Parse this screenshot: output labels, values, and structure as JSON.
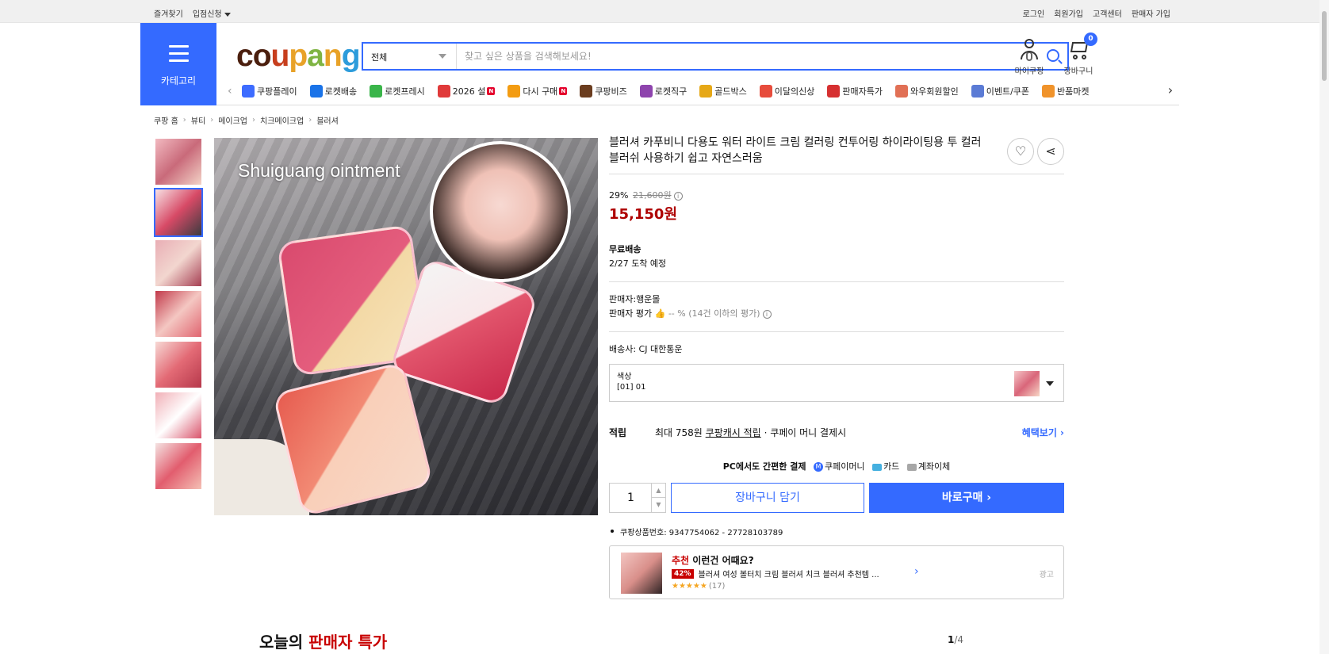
{
  "topbar": {
    "left": [
      "즐겨찾기",
      "입점신청"
    ],
    "right": [
      "로그인",
      "회원가입",
      "고객센터",
      "판매자 가입"
    ]
  },
  "header": {
    "category_label": "카테고리",
    "logo": "coupang",
    "logo_colors": [
      "#4b1f0e",
      "#c73e1d",
      "#e8a228",
      "#7fb443",
      "#2d9cdb"
    ],
    "search_category": "전체",
    "search_placeholder": "찾고 싶은 상품을 검색해보세요!",
    "mycoupang": "마이쿠팡",
    "cart": "장바구니",
    "cart_count": "0"
  },
  "nav": [
    {
      "label": "쿠팡플레이",
      "icon": "play-icon",
      "color": "#3d6cff",
      "badge": ""
    },
    {
      "label": "로켓배송",
      "icon": "rocket-icon",
      "color": "#1a73e8",
      "badge": ""
    },
    {
      "label": "로켓프레시",
      "icon": "rocket-fresh-icon",
      "color": "#3ab54a",
      "badge": ""
    },
    {
      "label": "2026 설",
      "icon": "gift-icon",
      "color": "#e03a3a",
      "badge": "N"
    },
    {
      "label": "다시 구매",
      "icon": "house-icon",
      "color": "#f39c12",
      "badge": "N"
    },
    {
      "label": "쿠팡비즈",
      "icon": "biz-icon",
      "color": "#6b3d1f",
      "badge": ""
    },
    {
      "label": "로켓직구",
      "icon": "rocket-global-icon",
      "color": "#8e44ad",
      "badge": ""
    },
    {
      "label": "골드박스",
      "icon": "goldbox-icon",
      "color": "#e6a817",
      "badge": ""
    },
    {
      "label": "이달의신상",
      "icon": "new-icon",
      "color": "#e74c3c",
      "badge": ""
    },
    {
      "label": "판매자특가",
      "icon": "percent-icon",
      "color": "#d63031",
      "badge": ""
    },
    {
      "label": "와우회원할인",
      "icon": "wow-icon",
      "color": "#e17055",
      "badge": ""
    },
    {
      "label": "이벤트/쿠폰",
      "icon": "coupon-icon",
      "color": "#5b7bd5",
      "badge": ""
    },
    {
      "label": "반품마켓",
      "icon": "market-icon",
      "color": "#f0932b",
      "badge": ""
    }
  ],
  "breadcrumb": [
    "쿠팡 홈",
    "뷰티",
    "메이크업",
    "치크메이크업",
    "블러셔"
  ],
  "product": {
    "image_caption": "Shuiguang ointment",
    "title": "블러셔 카푸비니 다용도 워터 라이트 크림 컬러링 컨투어링 하이라이팅용 투 컬러 블러쉬 사용하기 쉽고 자연스러움",
    "discount": "29%",
    "original_price": "21,600원",
    "sale_price": "15,150원",
    "shipping_title": "무료배송",
    "arrival": "2/27 도착 예정",
    "seller": "판매자:행운몰",
    "seller_rating_label": "판매자 평가",
    "seller_rating_value": "-- % (14건 이하의 평가)",
    "courier": "배송사:  CJ 대한통운",
    "option_label": "색상",
    "option_value": "[01] 01",
    "accum_label": "적립",
    "accum_text1": "최대 758원",
    "accum_link": "쿠팡캐시 적립",
    "accum_text2": "· 쿠페이 머니 결제시",
    "benefit_link": "혜택보기 ›",
    "pay_title": "PC에서도 간편한 결제",
    "pay_methods": [
      "쿠페이머니",
      "카드",
      "계좌이체"
    ],
    "quantity": "1",
    "cart_button": "장바구니 담기",
    "buy_button": "바로구매 ›",
    "product_number": "쿠팡상품번호: 9347754062 - 27728103789"
  },
  "recommend": {
    "tag": "추천",
    "title": "이런건 어때요?",
    "discount": "42%",
    "name": "블러셔 여성 볼터치 크림 블러셔 치크 블러셔 추천템 ...",
    "stars": "★★★★★",
    "reviews": "(17)",
    "ad": "광고"
  },
  "bottom": {
    "title_a": "오늘의 ",
    "title_b": "판매자 특가",
    "page": "1",
    "total": "/4"
  }
}
